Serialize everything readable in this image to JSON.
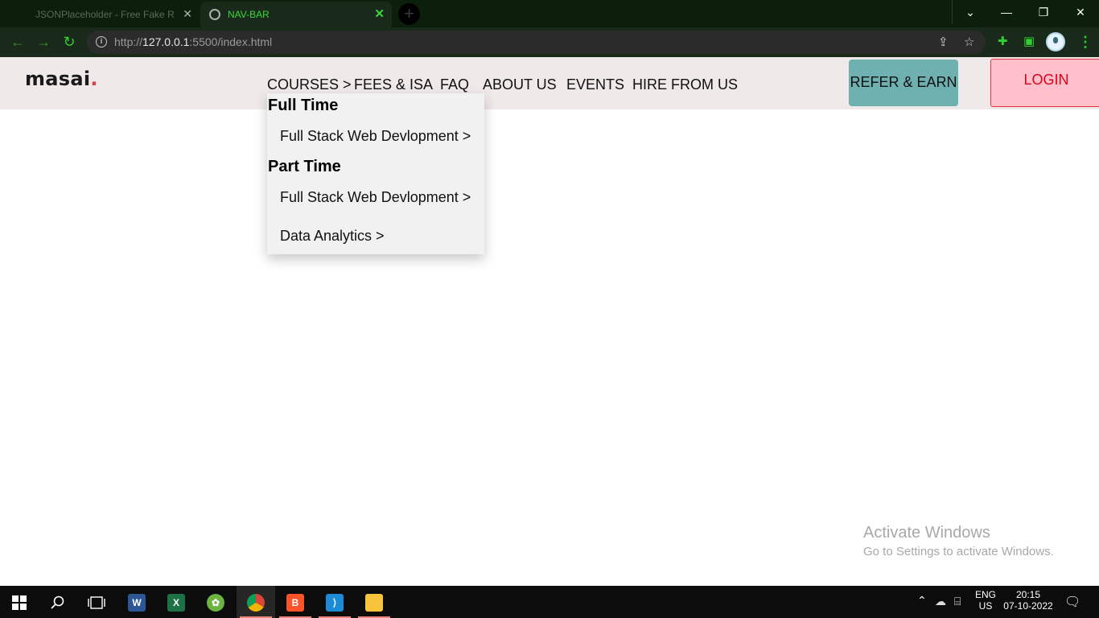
{
  "browser": {
    "tabs": [
      {
        "title": "JSONPlaceholder - Free Fake Rest",
        "active": false
      },
      {
        "title": "NAV-BAR",
        "active": true
      }
    ],
    "url_prefix": "http://",
    "url_host": "127.0.0.1",
    "url_rest": ":5500/index.html",
    "accent_color": "#2fd02f"
  },
  "site": {
    "logo": "masai",
    "logo_dot": ".",
    "nav": [
      "COURSES >",
      "FEES & ISA",
      "FAQ",
      "ABOUT US",
      "EVENTS",
      "HIRE FROM US"
    ],
    "refer_button": "REFER & EARN",
    "login_button": "LOGIN",
    "dropdown": {
      "full_time_heading": "Full Time",
      "full_time_items": [
        "Full Stack Web Devlopment >"
      ],
      "part_time_heading": "Part Time",
      "part_time_items": [
        "Full Stack Web Devlopment >",
        "Data Analytics >"
      ]
    }
  },
  "watermark": {
    "title": "Activate Windows",
    "subtitle": "Go to Settings to activate Windows."
  },
  "taskbar": {
    "language_top": "ENG",
    "language_bottom": "US",
    "time": "20:15",
    "date": "07-10-2022"
  }
}
